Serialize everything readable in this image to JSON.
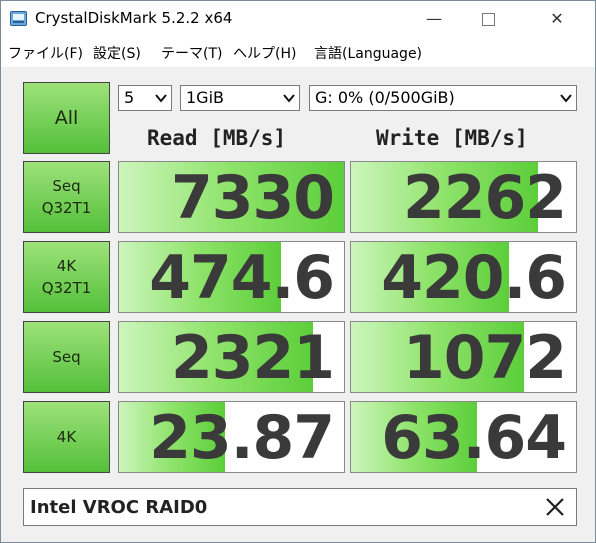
{
  "window": {
    "title": "CrystalDiskMark 5.2.2 x64",
    "minimize": "—",
    "close": "✕"
  },
  "menu": [
    "ファイル(F)",
    "設定(S)",
    "テーマ(T)",
    "ヘルプ(H)",
    "言語(Language)"
  ],
  "controls": {
    "all_label": "All",
    "count": "5",
    "size": "1GiB",
    "drive": "G: 0% (0/500GiB)"
  },
  "headers": {
    "read": "Read [MB/s]",
    "write": "Write [MB/s]"
  },
  "rows": [
    {
      "label": "Seq\nQ32T1",
      "read": "7330",
      "write": "2262",
      "read_fill": 1.0,
      "write_fill": 0.83
    },
    {
      "label": "4K\nQ32T1",
      "read": "474.6",
      "write": "420.6",
      "read_fill": 0.72,
      "write_fill": 0.7
    },
    {
      "label": "Seq",
      "read": "2321",
      "write": "1072",
      "read_fill": 0.86,
      "write_fill": 0.77
    },
    {
      "label": "4K",
      "read": "23.87",
      "write": "63.64",
      "read_fill": 0.47,
      "write_fill": 0.56
    }
  ],
  "comment": {
    "text": "Intel VROC RAID0"
  },
  "colors": {
    "accent_green": "#5cce3a",
    "title_bg": "#ffffff",
    "panel_bg": "#f0f0f0"
  },
  "icons": {
    "app": "disk-icon",
    "dropdown": "chevron-down-icon",
    "clear": "close-icon"
  }
}
